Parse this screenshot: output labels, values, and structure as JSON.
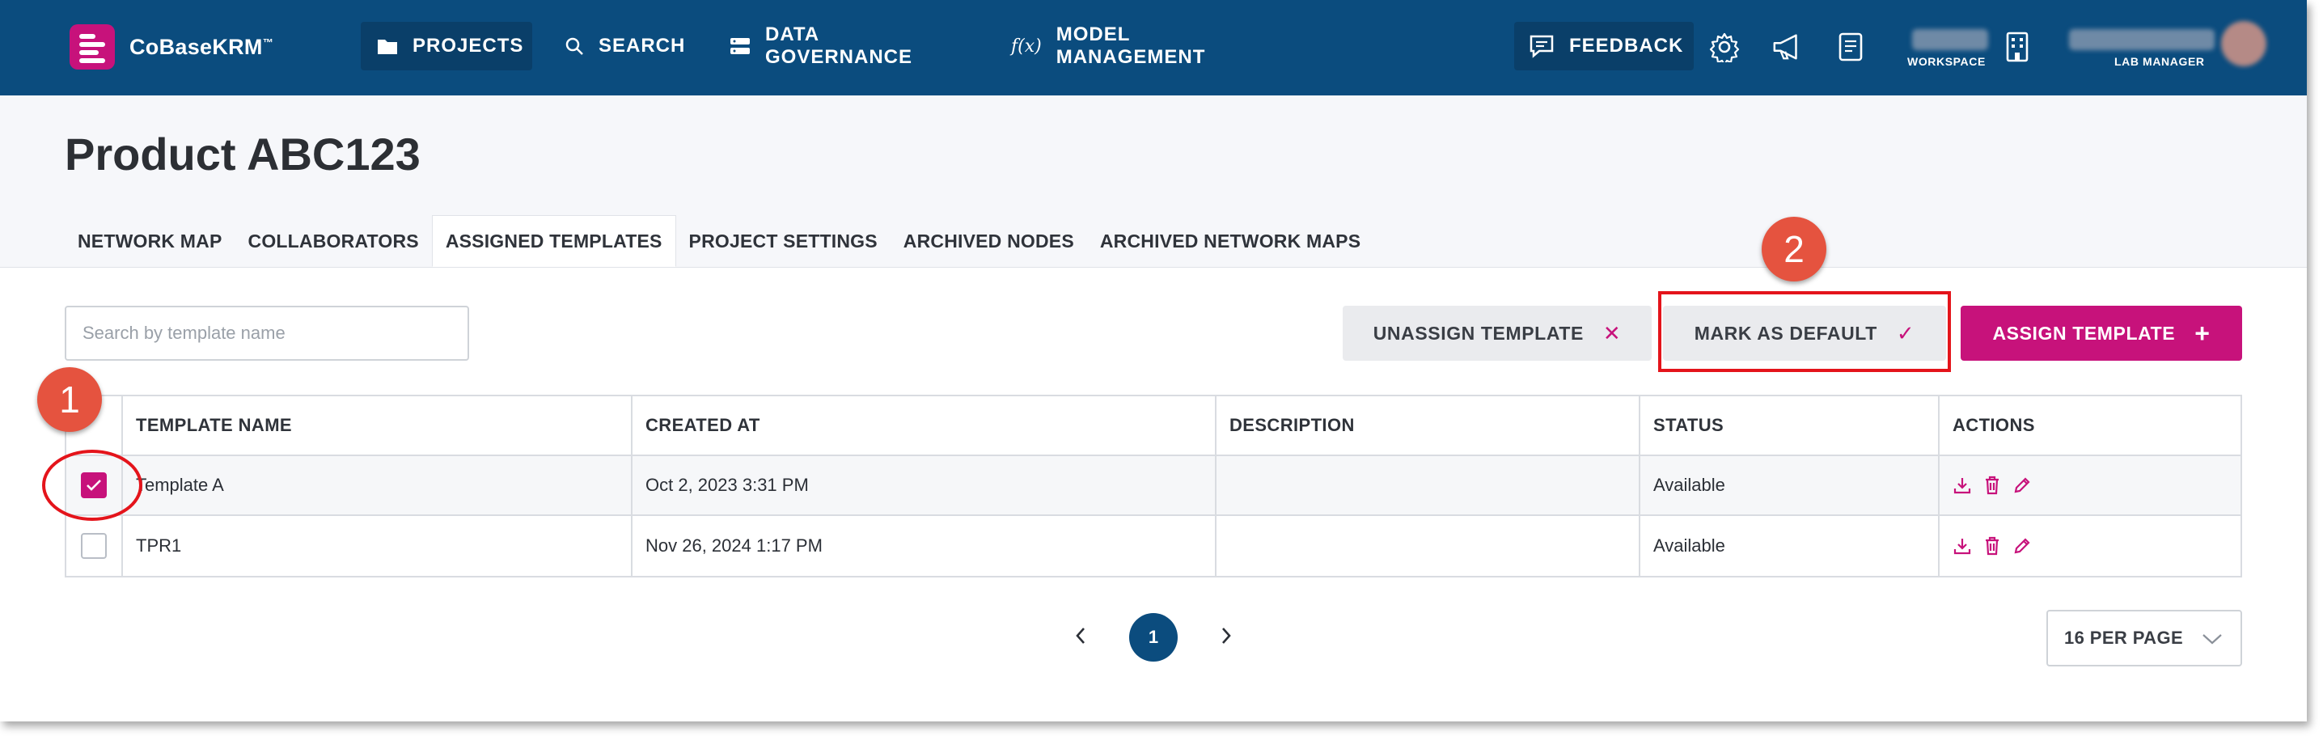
{
  "app": {
    "name": "CoBaseKRM",
    "trademark": "™"
  },
  "nav": {
    "items": [
      {
        "label": "PROJECTS",
        "icon": "folder-icon",
        "active": true
      },
      {
        "label": "SEARCH",
        "icon": "search-icon",
        "active": false
      },
      {
        "label": "DATA GOVERNANCE",
        "icon": "database-icon",
        "active": false
      },
      {
        "label": "MODEL MANAGEMENT",
        "icon": "function-icon",
        "active": false
      }
    ],
    "feedback_label": "FEEDBACK",
    "workspace_label": "WORKSPACE",
    "role_label": "LAB MANAGER"
  },
  "page": {
    "title": "Product ABC123",
    "tabs": [
      {
        "label": "NETWORK MAP",
        "active": false
      },
      {
        "label": "COLLABORATORS",
        "active": false
      },
      {
        "label": "ASSIGNED TEMPLATES",
        "active": true
      },
      {
        "label": "PROJECT SETTINGS",
        "active": false
      },
      {
        "label": "ARCHIVED NODES",
        "active": false
      },
      {
        "label": "ARCHIVED NETWORK MAPS",
        "active": false
      }
    ]
  },
  "toolbar": {
    "search_placeholder": "Search by template name",
    "search_value": "",
    "unassign_label": "UNASSIGN TEMPLATE",
    "mark_default_label": "MARK AS DEFAULT",
    "assign_label": "ASSIGN TEMPLATE"
  },
  "callouts": {
    "one": "1",
    "two": "2"
  },
  "table": {
    "columns": [
      "TEMPLATE NAME",
      "CREATED AT",
      "DESCRIPTION",
      "STATUS",
      "ACTIONS"
    ],
    "rows": [
      {
        "checked": true,
        "name": "Template A",
        "created_at": "Oct 2, 2023 3:31 PM",
        "description": "",
        "status": "Available"
      },
      {
        "checked": false,
        "name": "TPR1",
        "created_at": "Nov 26, 2024 1:17 PM",
        "description": "",
        "status": "Available"
      }
    ]
  },
  "pagination": {
    "current_page": "1",
    "per_page_label": "16 PER PAGE"
  },
  "colors": {
    "nav_bg": "#0b4c7e",
    "accent": "#c7127b",
    "annotation_red": "#e4141b",
    "callout": "#e5533f"
  }
}
